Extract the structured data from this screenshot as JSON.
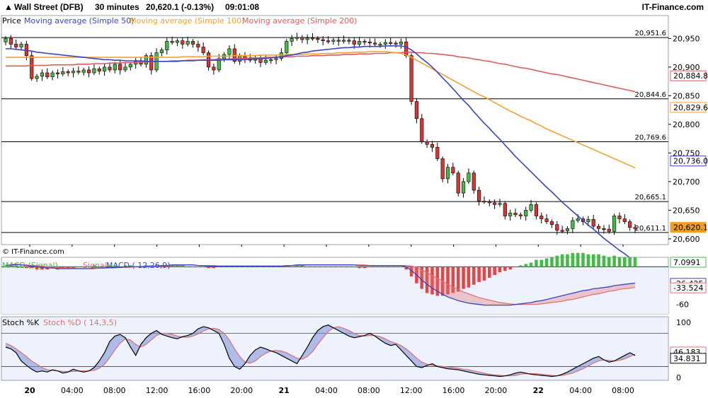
{
  "header": {
    "title": "Wall Street (DFB)",
    "timeframe": "30 minutes",
    "quote": "20,620.1 (-0.13%)",
    "time": "09:01:08",
    "brand": "IT-Finance.com"
  },
  "copyright": "© IT-Finance.com",
  "colors": {
    "background": "#ffffff",
    "panel_band": "#eef2fc",
    "ma50": "#3a44c2",
    "ma100": "#f5a032",
    "ma200": "#d85c5c",
    "candle_up": "#44bb44",
    "candle_down": "#dd3333",
    "macd_line": "#3a44c2",
    "macd_signal": "#e07070",
    "macd_hist_up": "#44bb44",
    "macd_hist_down": "#e04848",
    "stoch_k": "#000000",
    "stoch_d": "#e07070",
    "current_price_bg": "#f0a020"
  },
  "chart_data": [
    {
      "type": "candlestick",
      "name": "price",
      "legend": [
        "Price",
        "Moving average (Simple 50)",
        "Moving average (Simple 100)",
        "Moving average (Simple 200)"
      ],
      "x_ticks": [
        "20",
        "04:00",
        "08:00",
        "12:00",
        "16:00",
        "20:00",
        "21",
        "04:00",
        "08:00",
        "12:00",
        "16:00",
        "20:00",
        "22",
        "04:00",
        "08:00"
      ],
      "y_ticks": [
        "20,950",
        "20,900",
        "20,850",
        "20,800",
        "20,750",
        "20,700",
        "20,650",
        "20,600"
      ],
      "ylim": [
        20590,
        20990
      ],
      "levels": [
        {
          "value": 20951.6,
          "label": "20,951.6"
        },
        {
          "value": 20844.6,
          "label": "20,844.6"
        },
        {
          "value": 20769.6,
          "label": "20,769.6"
        },
        {
          "value": 20665.1,
          "label": "20,665.1"
        },
        {
          "value": 20611.1,
          "label": "20,611.1"
        }
      ],
      "price_tags": [
        {
          "value": 20884.8,
          "label": "20,884.8",
          "color": "#d85c5c"
        },
        {
          "value": 20829.6,
          "label": "20,829.6",
          "color": "#f5a032"
        },
        {
          "value": 20736.0,
          "label": "20,736.0",
          "color": "#3a44c2"
        },
        {
          "value": 20620.1,
          "label": "20,620.1",
          "color": "#f0a020"
        }
      ],
      "series": {
        "close": [
          20950,
          20940,
          20935,
          20940,
          20920,
          20880,
          20884,
          20890,
          20883,
          20890,
          20888,
          20892,
          20890,
          20893,
          20891,
          20895,
          20890,
          20897,
          20893,
          20900,
          20895,
          20905,
          20895,
          20900,
          20905,
          20910,
          20905,
          20920,
          20895,
          20925,
          20930,
          20945,
          20943,
          20946,
          20940,
          20945,
          20940,
          20935,
          20925,
          20900,
          20895,
          20915,
          20922,
          20932,
          20910,
          20920,
          20915,
          20912,
          20915,
          20908,
          20912,
          20913,
          20915,
          20925,
          20945,
          20950,
          20952,
          20948,
          20951,
          20950,
          20948,
          20946,
          20945,
          20947,
          20945,
          20947,
          20946,
          20940,
          20945,
          20944,
          20942,
          20940,
          20940,
          20943,
          20942,
          20940,
          20944,
          20920,
          20840,
          20810,
          20770,
          20765,
          20760,
          20740,
          20705,
          20725,
          20715,
          20680,
          20700,
          20715,
          20685,
          20666,
          20665,
          20663,
          20660,
          20662,
          20640,
          20645,
          20642,
          20640,
          20650,
          20660,
          20640,
          20635,
          20630,
          20625,
          20615,
          20614,
          20618,
          20632,
          20635,
          20630,
          20634,
          20622,
          20618,
          20617,
          20613,
          20640,
          20635,
          20630,
          20620,
          20618
        ],
        "ma50": [
          20932,
          20932,
          20931,
          20930,
          20929,
          20928,
          20926,
          20925,
          20924,
          20923,
          20922,
          20921,
          20920,
          20919,
          20918,
          20917,
          20916,
          20915,
          20914,
          20913,
          20913,
          20912,
          20912,
          20911,
          20911,
          20911,
          20911,
          20910,
          20910,
          20910,
          20910,
          20910,
          20910,
          20910,
          20911,
          20911,
          20911,
          20912,
          20912,
          20912,
          20912,
          20912,
          20913,
          20913,
          20913,
          20913,
          20913,
          20914,
          20914,
          20915,
          20915,
          20916,
          20917,
          20918,
          20920,
          20921,
          20923,
          20925,
          20926,
          20928,
          20929,
          20930,
          20931,
          20932,
          20933,
          20934,
          20934,
          20935,
          20935,
          20936,
          20936,
          20936,
          20936,
          20937,
          20937,
          20937,
          20937,
          20935,
          20930,
          20923,
          20915,
          20908,
          20900,
          20891,
          20881,
          20872,
          20862,
          20852,
          20842,
          20833,
          20822,
          20812,
          20802,
          20793,
          20783,
          20774,
          20764,
          20754,
          20744,
          20735,
          20726,
          20717,
          20708,
          20699,
          20690,
          20682,
          20673,
          20664,
          20656,
          20648,
          20640,
          20632,
          20624,
          20617,
          20609,
          20601,
          20594,
          20587,
          20580,
          20574,
          20567,
          20561
        ],
        "ma100": [
          20917,
          20917,
          20917,
          20917,
          20917,
          20917,
          20917,
          20917,
          20917,
          20917,
          20917,
          20917,
          20917,
          20917,
          20917,
          20917,
          20917,
          20917,
          20917,
          20917,
          20917,
          20917,
          20917,
          20917,
          20917,
          20917,
          20917,
          20917,
          20917,
          20917,
          20917,
          20917,
          20917,
          20917,
          20918,
          20918,
          20918,
          20918,
          20918,
          20919,
          20919,
          20919,
          20919,
          20919,
          20920,
          20920,
          20920,
          20920,
          20920,
          20921,
          20921,
          20921,
          20921,
          20921,
          20922,
          20922,
          20922,
          20922,
          20923,
          20923,
          20923,
          20924,
          20924,
          20924,
          20925,
          20925,
          20925,
          20926,
          20926,
          20926,
          20927,
          20927,
          20927,
          20927,
          20926,
          20925,
          20924,
          20921,
          20917,
          20912,
          20907,
          20902,
          20897,
          20892,
          20887,
          20882,
          20877,
          20872,
          20867,
          20862,
          20857,
          20852,
          20848,
          20843,
          20838,
          20833,
          20828,
          20823,
          20819,
          20814,
          20810,
          20806,
          20801,
          20797,
          20792,
          20788,
          20784,
          20780,
          20776,
          20772,
          20768,
          20764,
          20760,
          20756,
          20752,
          20748,
          20744,
          20740,
          20736,
          20732,
          20728,
          20724
        ],
        "ma200": [
          20902,
          20902,
          20902,
          20902,
          20902,
          20903,
          20903,
          20903,
          20903,
          20904,
          20904,
          20904,
          20904,
          20904,
          20905,
          20905,
          20905,
          20906,
          20906,
          20906,
          20907,
          20907,
          20907,
          20908,
          20908,
          20908,
          20909,
          20909,
          20909,
          20910,
          20910,
          20910,
          20911,
          20911,
          20911,
          20912,
          20912,
          20912,
          20913,
          20913,
          20913,
          20914,
          20914,
          20914,
          20915,
          20915,
          20915,
          20916,
          20916,
          20916,
          20917,
          20917,
          20917,
          20918,
          20918,
          20918,
          20919,
          20919,
          20919,
          20920,
          20920,
          20920,
          20921,
          20921,
          20921,
          20922,
          20922,
          20922,
          20923,
          20923,
          20923,
          20924,
          20924,
          20924,
          20925,
          20925,
          20925,
          20926,
          20926,
          20925,
          20925,
          20924,
          20924,
          20923,
          20922,
          20921,
          20920,
          20918,
          20917,
          20916,
          20914,
          20913,
          20911,
          20910,
          20908,
          20906,
          20905,
          20903,
          20901,
          20899,
          20898,
          20896,
          20894,
          20892,
          20890,
          20888,
          20887,
          20885,
          20883,
          20881,
          20879,
          20877,
          20875,
          20873,
          20871,
          20869,
          20867,
          20865,
          20863,
          20861,
          20859,
          20857
        ]
      }
    },
    {
      "type": "bar+line",
      "name": "macd",
      "legend": [
        "MACD (Signal)",
        "Signal",
        "MACD ( 12,26,9)"
      ],
      "y_ticks": [
        "-60"
      ],
      "ylim": [
        -75,
        15
      ],
      "price_tags": [
        {
          "value": 7.0991,
          "label": "7.0991",
          "color": "#44bb44"
        },
        {
          "value": -26.425,
          "label": "-26.425",
          "color": "#3a44c2"
        },
        {
          "value": -33.524,
          "label": "-33.524",
          "color": "#e07070"
        }
      ],
      "series": {
        "macd": [
          2,
          3,
          4,
          3,
          2,
          1,
          0,
          -1,
          -2,
          -2,
          -3,
          -3,
          -3,
          -3,
          -3,
          -3,
          -3,
          -2,
          -2,
          -2,
          -1,
          -1,
          -1,
          0,
          0,
          0,
          0,
          1,
          1,
          1,
          2,
          2,
          3,
          3,
          3,
          3,
          3,
          2,
          2,
          1,
          1,
          1,
          1,
          1,
          1,
          1,
          1,
          1,
          1,
          1,
          1,
          1,
          1,
          1,
          2,
          2,
          3,
          3,
          3,
          3,
          3,
          3,
          3,
          3,
          3,
          3,
          3,
          3,
          2,
          2,
          2,
          2,
          2,
          2,
          2,
          2,
          2,
          0,
          -6,
          -13,
          -21,
          -28,
          -34,
          -39,
          -44,
          -48,
          -51,
          -54,
          -56,
          -58,
          -59,
          -60,
          -61,
          -61,
          -61,
          -61,
          -61,
          -61,
          -60,
          -59,
          -58,
          -57,
          -55,
          -54,
          -52,
          -50,
          -48,
          -46,
          -44,
          -42,
          -40,
          -38,
          -37,
          -35,
          -34,
          -33,
          -32,
          -30,
          -29,
          -28,
          -27,
          -26
        ],
        "signal": [
          2,
          2,
          3,
          3,
          3,
          2,
          2,
          1,
          0,
          -1,
          -1,
          -2,
          -2,
          -2,
          -3,
          -3,
          -3,
          -3,
          -2,
          -2,
          -2,
          -2,
          -1,
          -1,
          -1,
          0,
          0,
          0,
          0,
          0,
          1,
          1,
          2,
          2,
          2,
          3,
          3,
          2,
          2,
          2,
          2,
          1,
          1,
          1,
          1,
          1,
          1,
          1,
          1,
          1,
          1,
          1,
          1,
          1,
          1,
          2,
          2,
          2,
          3,
          3,
          3,
          3,
          3,
          3,
          3,
          3,
          3,
          3,
          3,
          3,
          2,
          2,
          2,
          2,
          2,
          2,
          2,
          2,
          1,
          -1,
          -5,
          -9,
          -14,
          -18,
          -23,
          -28,
          -32,
          -36,
          -40,
          -43,
          -46,
          -49,
          -51,
          -53,
          -55,
          -57,
          -58,
          -59,
          -60,
          -60,
          -60,
          -60,
          -60,
          -59,
          -58,
          -57,
          -56,
          -55,
          -53,
          -52,
          -50,
          -48,
          -46,
          -44,
          -43,
          -41,
          -39,
          -38,
          -36,
          -35,
          -34,
          -33
        ]
      }
    },
    {
      "type": "line",
      "name": "stochastic",
      "legend": [
        "Stoch %K",
        "Stoch %D ( 14,3,5)"
      ],
      "y_ticks": [
        "100",
        "50",
        "0"
      ],
      "ylim": [
        -5,
        110
      ],
      "price_tags": [
        {
          "value": 46.183,
          "label": "46.183",
          "color": "#e07070"
        },
        {
          "value": 34.831,
          "label": "34.831",
          "color": "#000000"
        }
      ],
      "series": {
        "k": [
          55,
          52,
          45,
          30,
          22,
          15,
          10,
          12,
          10,
          14,
          12,
          8,
          10,
          15,
          12,
          10,
          12,
          18,
          30,
          45,
          65,
          75,
          78,
          72,
          55,
          40,
          60,
          72,
          80,
          85,
          78,
          75,
          72,
          70,
          74,
          76,
          80,
          88,
          92,
          90,
          85,
          80,
          60,
          35,
          20,
          15,
          25,
          40,
          50,
          55,
          52,
          48,
          45,
          40,
          35,
          30,
          25,
          40,
          55,
          72,
          85,
          92,
          95,
          90,
          85,
          80,
          75,
          72,
          74,
          76,
          80,
          75,
          68,
          62,
          58,
          60,
          50,
          40,
          30,
          20,
          18,
          22,
          25,
          20,
          18,
          16,
          15,
          14,
          12,
          10,
          8,
          6,
          5,
          4,
          3,
          2,
          3,
          5,
          8,
          10,
          8,
          6,
          5,
          4,
          3,
          2,
          3,
          6,
          10,
          15,
          20,
          25,
          30,
          35,
          38,
          32,
          28,
          30,
          35,
          40,
          45,
          40
        ],
        "d": [
          62,
          58,
          52,
          45,
          38,
          30,
          24,
          18,
          14,
          13,
          12,
          11,
          11,
          11,
          12,
          12,
          12,
          13,
          17,
          24,
          36,
          50,
          62,
          70,
          68,
          60,
          55,
          60,
          68,
          76,
          80,
          80,
          78,
          75,
          73,
          73,
          75,
          79,
          84,
          88,
          89,
          87,
          80,
          68,
          52,
          38,
          28,
          26,
          30,
          38,
          44,
          48,
          49,
          48,
          45,
          40,
          35,
          33,
          38,
          47,
          60,
          72,
          83,
          90,
          92,
          89,
          85,
          80,
          76,
          75,
          76,
          76,
          74,
          70,
          65,
          62,
          58,
          52,
          44,
          35,
          28,
          24,
          22,
          21,
          20,
          19,
          18,
          17,
          15,
          14,
          12,
          10,
          8,
          6,
          5,
          4,
          3,
          3,
          4,
          6,
          7,
          7,
          7,
          6,
          5,
          4,
          3,
          4,
          6,
          8,
          12,
          16,
          21,
          26,
          30,
          32,
          31,
          30,
          31,
          34,
          38,
          42
        ]
      }
    }
  ]
}
